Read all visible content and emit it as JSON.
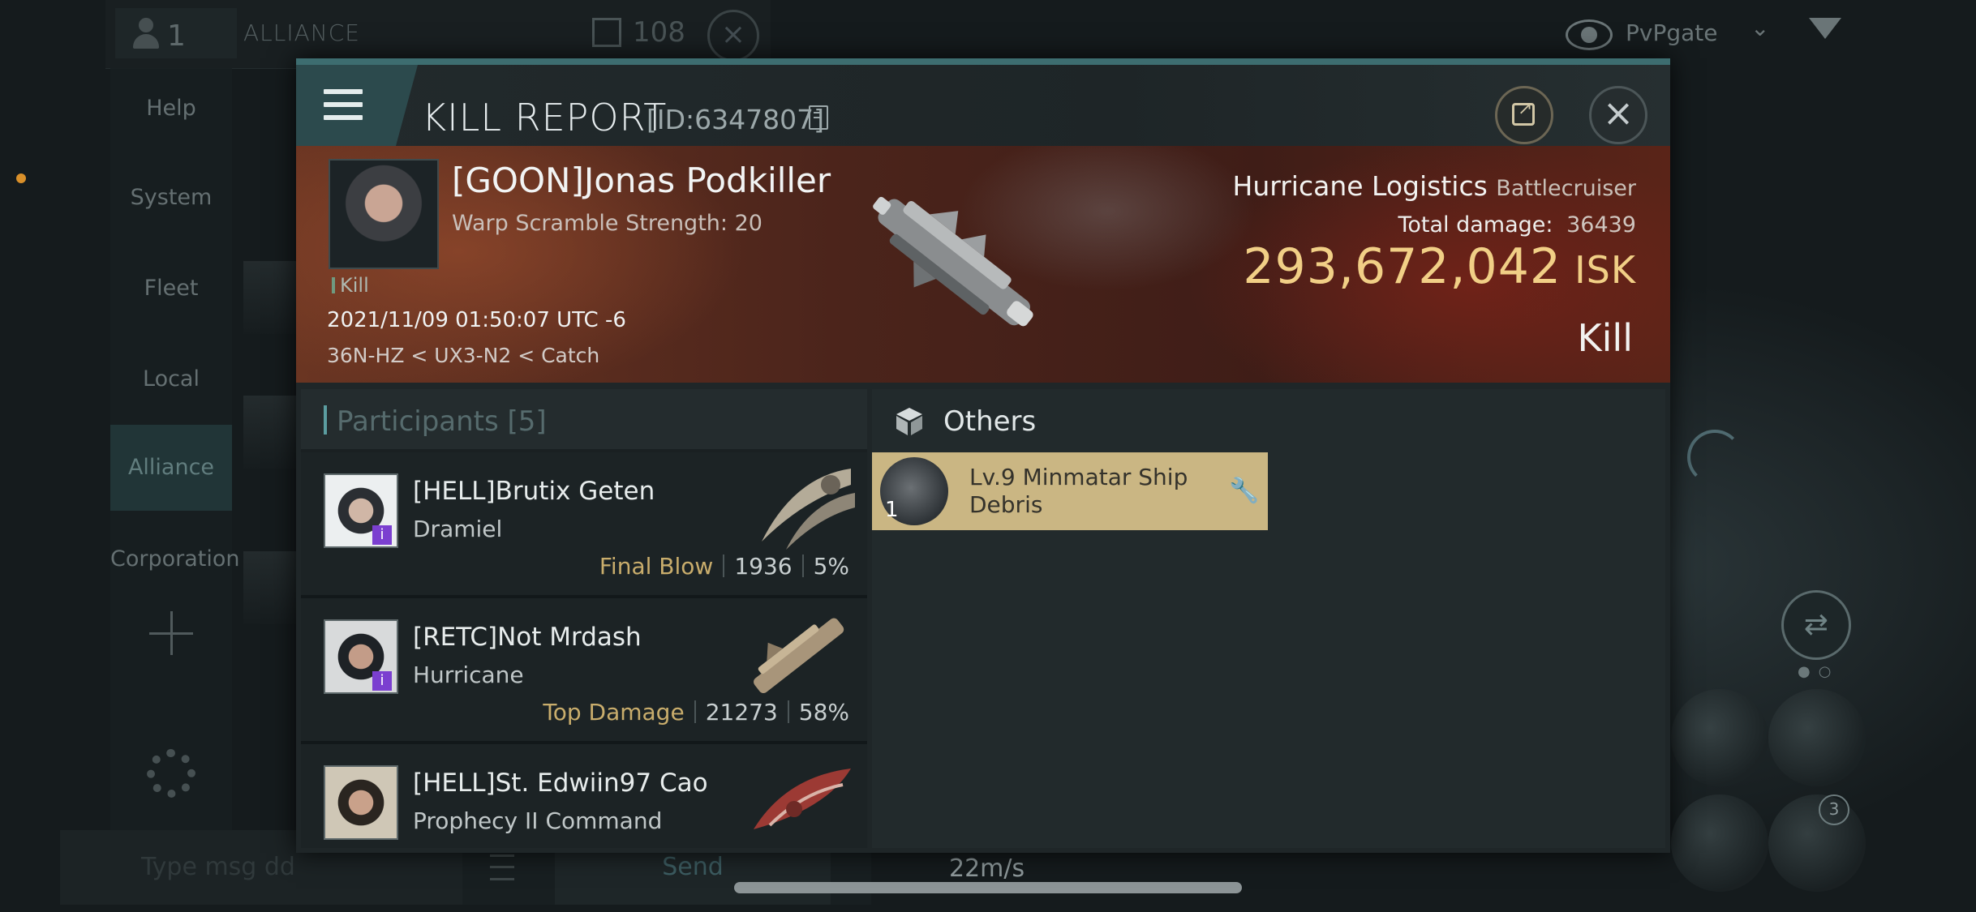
{
  "background": {
    "chat": {
      "member_count": "1",
      "channel_title": "ALLIANCE",
      "message_count": "108",
      "input_placeholder": "Type msg dd",
      "send_label": "Send"
    },
    "side_nav": {
      "items": [
        "Help",
        "System",
        "Fleet",
        "Local",
        "Alliance",
        "Corporation"
      ],
      "active": "Alliance"
    },
    "view_mode": "PvPgate",
    "speed": "22m/s",
    "module_badge": "3"
  },
  "report": {
    "title": "KILL REPORT",
    "id_label": "[ID:6347807]",
    "pilot_name": "[GOON]Jonas Podkiller",
    "warp_scramble": "Warp Scramble Strength: 20",
    "kill_tag": "Kill",
    "datetime": "2021/11/09 01:50:07 UTC -6",
    "route": "36N-HZ < UX3-N2 < Catch",
    "ship_name": "Hurricane Logistics",
    "ship_class": "Battlecruiser",
    "total_damage_label": "Total damage:",
    "total_damage": "36439",
    "isk_value": "293,672,042",
    "isk_unit": "ISK",
    "result": "Kill"
  },
  "participants": {
    "label": "Participants",
    "count": "[5]",
    "rows": [
      {
        "name": "[HELL]Brutix Geten",
        "ship": "Dramiel",
        "tag": "Final Blow",
        "damage": "1936",
        "percent": "5%"
      },
      {
        "name": "[RETC]Not Mrdash",
        "ship": "Hurricane",
        "tag": "Top Damage",
        "damage": "21273",
        "percent": "58%"
      },
      {
        "name": "[HELL]St. Edwiin97 Cao",
        "ship": "Prophecy II Command",
        "tag": "",
        "damage": "",
        "percent": ""
      }
    ]
  },
  "others": {
    "label": "Others",
    "items": [
      {
        "name": "Lv.9 Minmatar Ship Debris",
        "quantity": "1"
      }
    ]
  },
  "colors": {
    "accent": "#3d6d70",
    "isk_gold": "#f1cf86",
    "item_card": "#cab683",
    "tag_gold": "#c9ad6c"
  }
}
